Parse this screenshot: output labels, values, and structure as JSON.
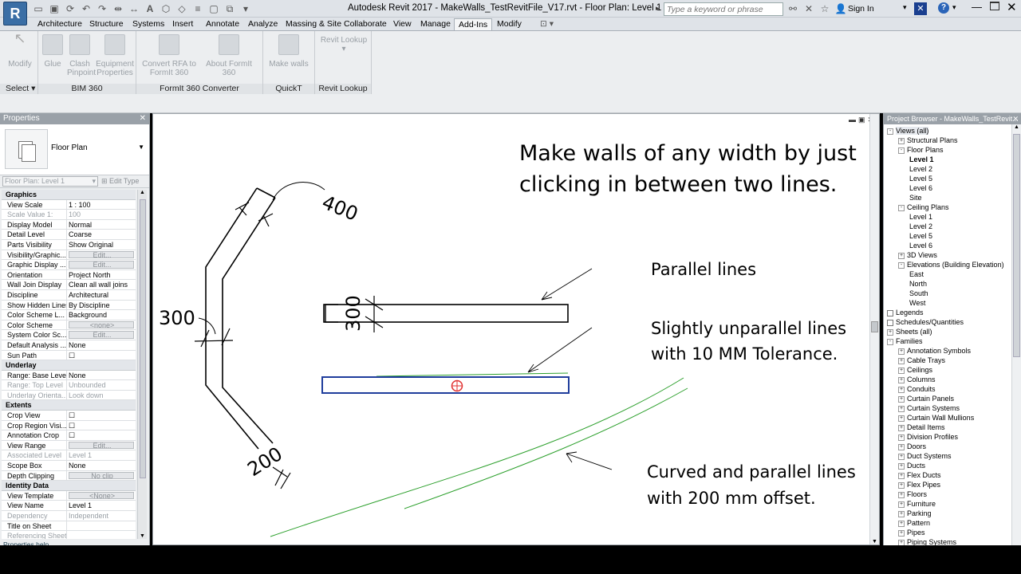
{
  "app": {
    "logo_letter": "R",
    "title": "Autodesk Revit 2017 -     MakeWalls_TestRevitFile_V17.rvt - Floor Plan: Level 1",
    "search_placeholder": "Type a keyword or phrase",
    "sign_in": "Sign In"
  },
  "tabs": [
    "Architecture",
    "Structure",
    "Systems",
    "Insert",
    "Annotate",
    "Analyze",
    "Massing & Site",
    "Collaborate",
    "View",
    "Manage",
    "Add-Ins",
    "Modify"
  ],
  "active_tab": "Add-Ins",
  "ribbon": {
    "modify": "Modify",
    "select_label": "Select",
    "bim360": {
      "glue": "Glue",
      "clash": "Clash Pinpoint",
      "equip": "Equipment Properties",
      "footer": "BIM 360"
    },
    "formit": {
      "convert": "Convert RFA to FormIt 360",
      "about": "About FormIt 360",
      "footer": "FormIt 360 Converter"
    },
    "quickt": {
      "make_walls": "Make walls",
      "footer": "QuickT"
    },
    "lookup": {
      "btn": "Revit Lookup",
      "footer": "Revit Lookup"
    }
  },
  "properties": {
    "header": "Properties",
    "type_name": "Floor Plan",
    "instance_selector": "Floor Plan: Level 1",
    "edit_type": "Edit Type",
    "help": "Properties help",
    "sections": [
      {
        "title": "Graphics",
        "rows": [
          [
            "View Scale",
            "1 : 100",
            ""
          ],
          [
            "Scale Value    1:",
            "100",
            "dim"
          ],
          [
            "Display Model",
            "Normal",
            ""
          ],
          [
            "Detail Level",
            "Coarse",
            ""
          ],
          [
            "Parts Visibility",
            "Show Original",
            ""
          ],
          [
            "Visibility/Graphic...",
            "Edit...",
            "btn"
          ],
          [
            "Graphic Display ...",
            "Edit...",
            "btn"
          ],
          [
            "Orientation",
            "Project North",
            ""
          ],
          [
            "Wall Join Display",
            "Clean all wall joins",
            ""
          ],
          [
            "Discipline",
            "Architectural",
            ""
          ],
          [
            "Show Hidden Lines",
            "By Discipline",
            ""
          ],
          [
            "Color Scheme L...",
            "Background",
            ""
          ],
          [
            "Color Scheme",
            "<none>",
            "btn"
          ],
          [
            "System Color Sc...",
            "Edit...",
            "btn"
          ],
          [
            "Default Analysis ...",
            "None",
            ""
          ],
          [
            "Sun Path",
            "☐",
            ""
          ]
        ]
      },
      {
        "title": "Underlay",
        "rows": [
          [
            "Range: Base Level",
            "None",
            ""
          ],
          [
            "Range: Top Level",
            "Unbounded",
            "dim"
          ],
          [
            "Underlay Orienta...",
            "Look down",
            "dim"
          ]
        ]
      },
      {
        "title": "Extents",
        "rows": [
          [
            "Crop View",
            "☐",
            ""
          ],
          [
            "Crop Region Visi...",
            "☐",
            ""
          ],
          [
            "Annotation Crop",
            "☐",
            ""
          ],
          [
            "View Range",
            "Edit...",
            "btn"
          ],
          [
            "Associated Level",
            "Level 1",
            "dim"
          ],
          [
            "Scope Box",
            "None",
            ""
          ],
          [
            "Depth Clipping",
            "No clip",
            "btn"
          ]
        ]
      },
      {
        "title": "Identity Data",
        "rows": [
          [
            "View Template",
            "<None>",
            "btn"
          ],
          [
            "View Name",
            "Level 1",
            ""
          ],
          [
            "Dependency",
            "Independent",
            "dim"
          ],
          [
            "Title on Sheet",
            "",
            ""
          ],
          [
            "Referencing Sheet",
            "",
            "dim"
          ]
        ]
      }
    ]
  },
  "canvas": {
    "heading_line1": "Make walls of any width by just",
    "heading_line2": "clicking in between two lines.",
    "parallel": "Parallel lines",
    "unparallel_1": "Slightly unparallel lines",
    "unparallel_2": "with 10 MM Tolerance.",
    "curved_1": "Curved and parallel lines",
    "curved_2": "with 200 mm offset.",
    "dim_400": "400",
    "dim_300_left": "300",
    "dim_300_wall": "300",
    "dim_200": "200",
    "colors": {
      "selected_wall": "#1f3d9c",
      "green_line": "#2da02d",
      "cursor": "#e03030"
    }
  },
  "browser": {
    "header": "Project Browser - MakeWalls_TestRevit...",
    "nodes": [
      {
        "label": "Views (all)",
        "indent": 0,
        "tog": "-",
        "bold": false
      },
      {
        "label": "Structural Plans",
        "indent": 1,
        "tog": "+"
      },
      {
        "label": "Floor Plans",
        "indent": 1,
        "tog": "-"
      },
      {
        "label": "Level 1",
        "indent": 2,
        "bold": true
      },
      {
        "label": "Level 2",
        "indent": 2
      },
      {
        "label": "Level 5",
        "indent": 2
      },
      {
        "label": "Level 6",
        "indent": 2
      },
      {
        "label": "Site",
        "indent": 2
      },
      {
        "label": "Ceiling Plans",
        "indent": 1,
        "tog": "-"
      },
      {
        "label": "Level 1",
        "indent": 2
      },
      {
        "label": "Level 2",
        "indent": 2
      },
      {
        "label": "Level 5",
        "indent": 2
      },
      {
        "label": "Level 6",
        "indent": 2
      },
      {
        "label": "3D Views",
        "indent": 1,
        "tog": "+"
      },
      {
        "label": "Elevations (Building Elevation)",
        "indent": 1,
        "tog": "-"
      },
      {
        "label": "East",
        "indent": 2
      },
      {
        "label": "North",
        "indent": 2
      },
      {
        "label": "South",
        "indent": 2
      },
      {
        "label": "West",
        "indent": 2
      },
      {
        "label": "Legends",
        "indent": 0
      },
      {
        "label": "Schedules/Quantities",
        "indent": 0
      },
      {
        "label": "Sheets (all)",
        "indent": 0,
        "tog": "+"
      },
      {
        "label": "Families",
        "indent": 0,
        "tog": "-"
      },
      {
        "label": "Annotation Symbols",
        "indent": 1,
        "tog": "+"
      },
      {
        "label": "Cable Trays",
        "indent": 1,
        "tog": "+"
      },
      {
        "label": "Ceilings",
        "indent": 1,
        "tog": "+"
      },
      {
        "label": "Columns",
        "indent": 1,
        "tog": "+"
      },
      {
        "label": "Conduits",
        "indent": 1,
        "tog": "+"
      },
      {
        "label": "Curtain Panels",
        "indent": 1,
        "tog": "+"
      },
      {
        "label": "Curtain Systems",
        "indent": 1,
        "tog": "+"
      },
      {
        "label": "Curtain Wall Mullions",
        "indent": 1,
        "tog": "+"
      },
      {
        "label": "Detail Items",
        "indent": 1,
        "tog": "+"
      },
      {
        "label": "Division Profiles",
        "indent": 1,
        "tog": "+"
      },
      {
        "label": "Doors",
        "indent": 1,
        "tog": "+"
      },
      {
        "label": "Duct Systems",
        "indent": 1,
        "tog": "+"
      },
      {
        "label": "Ducts",
        "indent": 1,
        "tog": "+"
      },
      {
        "label": "Flex Ducts",
        "indent": 1,
        "tog": "+"
      },
      {
        "label": "Flex Pipes",
        "indent": 1,
        "tog": "+"
      },
      {
        "label": "Floors",
        "indent": 1,
        "tog": "+"
      },
      {
        "label": "Furniture",
        "indent": 1,
        "tog": "+"
      },
      {
        "label": "Parking",
        "indent": 1,
        "tog": "+"
      },
      {
        "label": "Pattern",
        "indent": 1,
        "tog": "+"
      },
      {
        "label": "Pipes",
        "indent": 1,
        "tog": "+"
      },
      {
        "label": "Piping Systems",
        "indent": 1,
        "tog": "+"
      }
    ]
  }
}
